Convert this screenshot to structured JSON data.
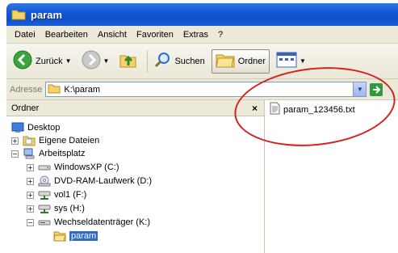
{
  "window": {
    "title": "param"
  },
  "menu": [
    "Datei",
    "Bearbeiten",
    "Ansicht",
    "Favoriten",
    "Extras",
    "?"
  ],
  "toolbar": {
    "back_label": "Zurück",
    "search_label": "Suchen",
    "folders_label": "Ordner"
  },
  "address": {
    "label": "Adresse",
    "value": "K:\\param"
  },
  "folders_pane": {
    "header": "Ordner",
    "close": "×",
    "tree": [
      {
        "label": "Desktop",
        "expander": "",
        "icon": "desktop-icon"
      },
      {
        "label": "Eigene Dateien",
        "expander": "+",
        "icon": "my-documents-icon"
      },
      {
        "label": "Arbeitsplatz",
        "expander": "−",
        "icon": "my-computer-icon"
      },
      {
        "label": "WindowsXP (C:)",
        "expander": "+",
        "icon": "hard-drive-icon"
      },
      {
        "label": "DVD-RAM-Laufwerk (D:)",
        "expander": "+",
        "icon": "dvd-drive-icon"
      },
      {
        "label": "vol1 (F:)",
        "expander": "+",
        "icon": "network-drive-icon"
      },
      {
        "label": "sys (H:)",
        "expander": "+",
        "icon": "network-drive-icon"
      },
      {
        "label": "Wechseldatenträger (K:)",
        "expander": "−",
        "icon": "removable-drive-icon"
      },
      {
        "label": "param",
        "expander": "",
        "icon": "folder-open-icon"
      }
    ]
  },
  "files": [
    {
      "name": "param_123456.txt",
      "icon": "text-file-icon"
    }
  ],
  "colors": {
    "title_bar": "#0f4fc9",
    "selection": "#316ac5",
    "highlight_ring": "#d6211d"
  }
}
